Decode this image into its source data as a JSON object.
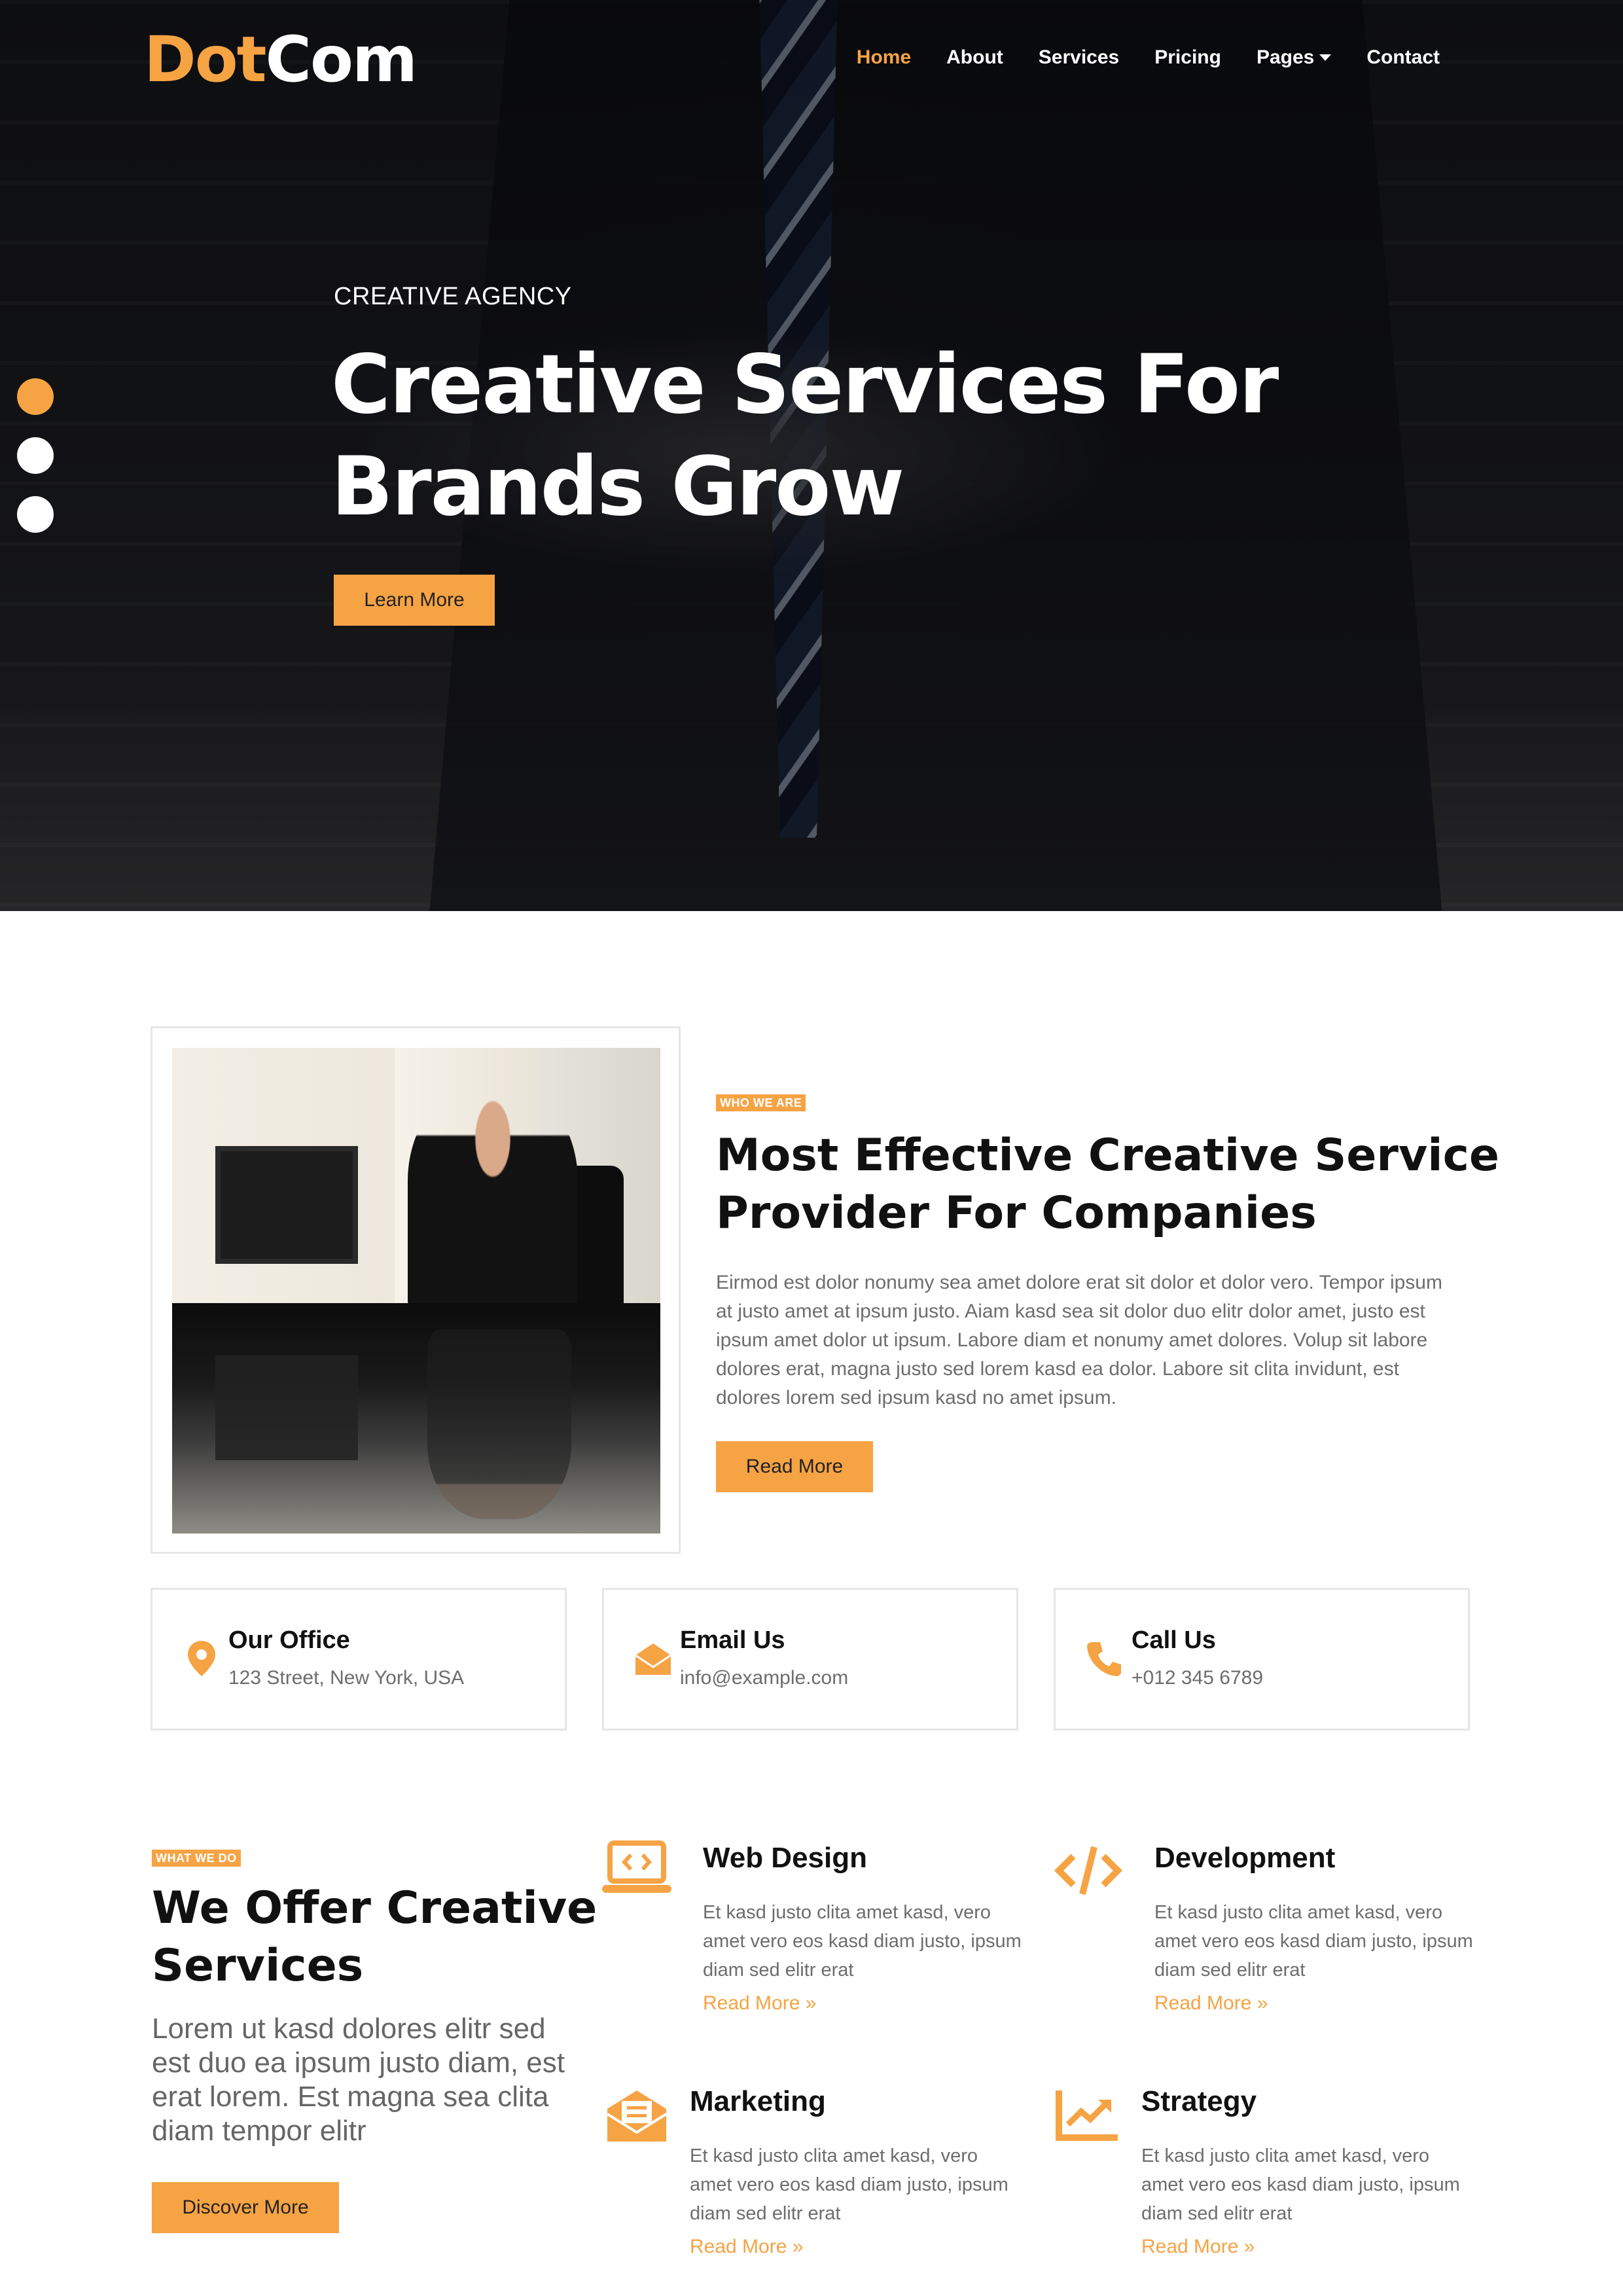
{
  "brand": {
    "part1": "Dot",
    "part2": "Com"
  },
  "nav": {
    "items": [
      {
        "label": "Home"
      },
      {
        "label": "About"
      },
      {
        "label": "Services"
      },
      {
        "label": "Pricing"
      },
      {
        "label": "Pages"
      },
      {
        "label": "Contact"
      }
    ],
    "active": "Home"
  },
  "hero": {
    "kicker": "CREATIVE AGENCY",
    "title_line1": "Creative Services For",
    "title_line2": "Brands Grow",
    "button": "Learn More",
    "slide_count": 3,
    "active_slide": 1
  },
  "about": {
    "tag": "WHO WE ARE",
    "title_line1": "Most Effective Creative Service",
    "title_line2": "Provider For Companies",
    "text": "Eirmod est dolor nonumy sea amet dolore erat sit dolor et dolor vero. Tempor ipsum at justo amet at ipsum justo. Aiam kasd sea sit dolor duo elitr dolor amet, justo est ipsum amet dolor ut ipsum. Labore diam et nonumy amet dolores. Volup sit labore dolores erat, magna justo sed lorem kasd ea dolor. Labore sit clita invidunt, est dolores lorem sed ipsum kasd no amet ipsum.",
    "button": "Read More"
  },
  "contact": [
    {
      "title": "Our Office",
      "value": "123 Street, New York, USA",
      "icon": "map-marker-icon"
    },
    {
      "title": "Email Us",
      "value": "info@example.com",
      "icon": "envelope-open-icon"
    },
    {
      "title": "Call Us",
      "value": "+012 345 6789",
      "icon": "phone-icon"
    }
  ],
  "services": {
    "tag": "WHAT WE DO",
    "title_line1": "We Offer Creative",
    "title_line2": "Services",
    "lead": "Lorem ut kasd dolores elitr sed est duo ea ipsum justo diam, est erat lorem. Est magna sea clita diam tempor elitr",
    "button": "Discover More",
    "items": [
      {
        "title": "Web Design",
        "text": "Et kasd justo clita amet kasd, vero amet vero eos kasd diam justo, ipsum diam sed elitr erat",
        "link": "Read More",
        "icon": "laptop-code-icon"
      },
      {
        "title": "Development",
        "text": "Et kasd justo clita amet kasd, vero amet vero eos kasd diam justo, ipsum diam sed elitr erat",
        "link": "Read More",
        "icon": "code-icon"
      },
      {
        "title": "Marketing",
        "text": "Et kasd justo clita amet kasd, vero amet vero eos kasd diam justo, ipsum diam sed elitr erat",
        "link": "Read More",
        "icon": "mail-bulk-icon"
      },
      {
        "title": "Strategy",
        "text": "Et kasd justo clita amet kasd, vero amet vero eos kasd diam justo, ipsum diam sed elitr erat",
        "link": "Read More",
        "icon": "chart-line-icon"
      }
    ]
  },
  "colors": {
    "accent": "#f6a344",
    "heading": "#111111",
    "body_text": "#6d6d6d",
    "border": "#e6e6e6"
  }
}
